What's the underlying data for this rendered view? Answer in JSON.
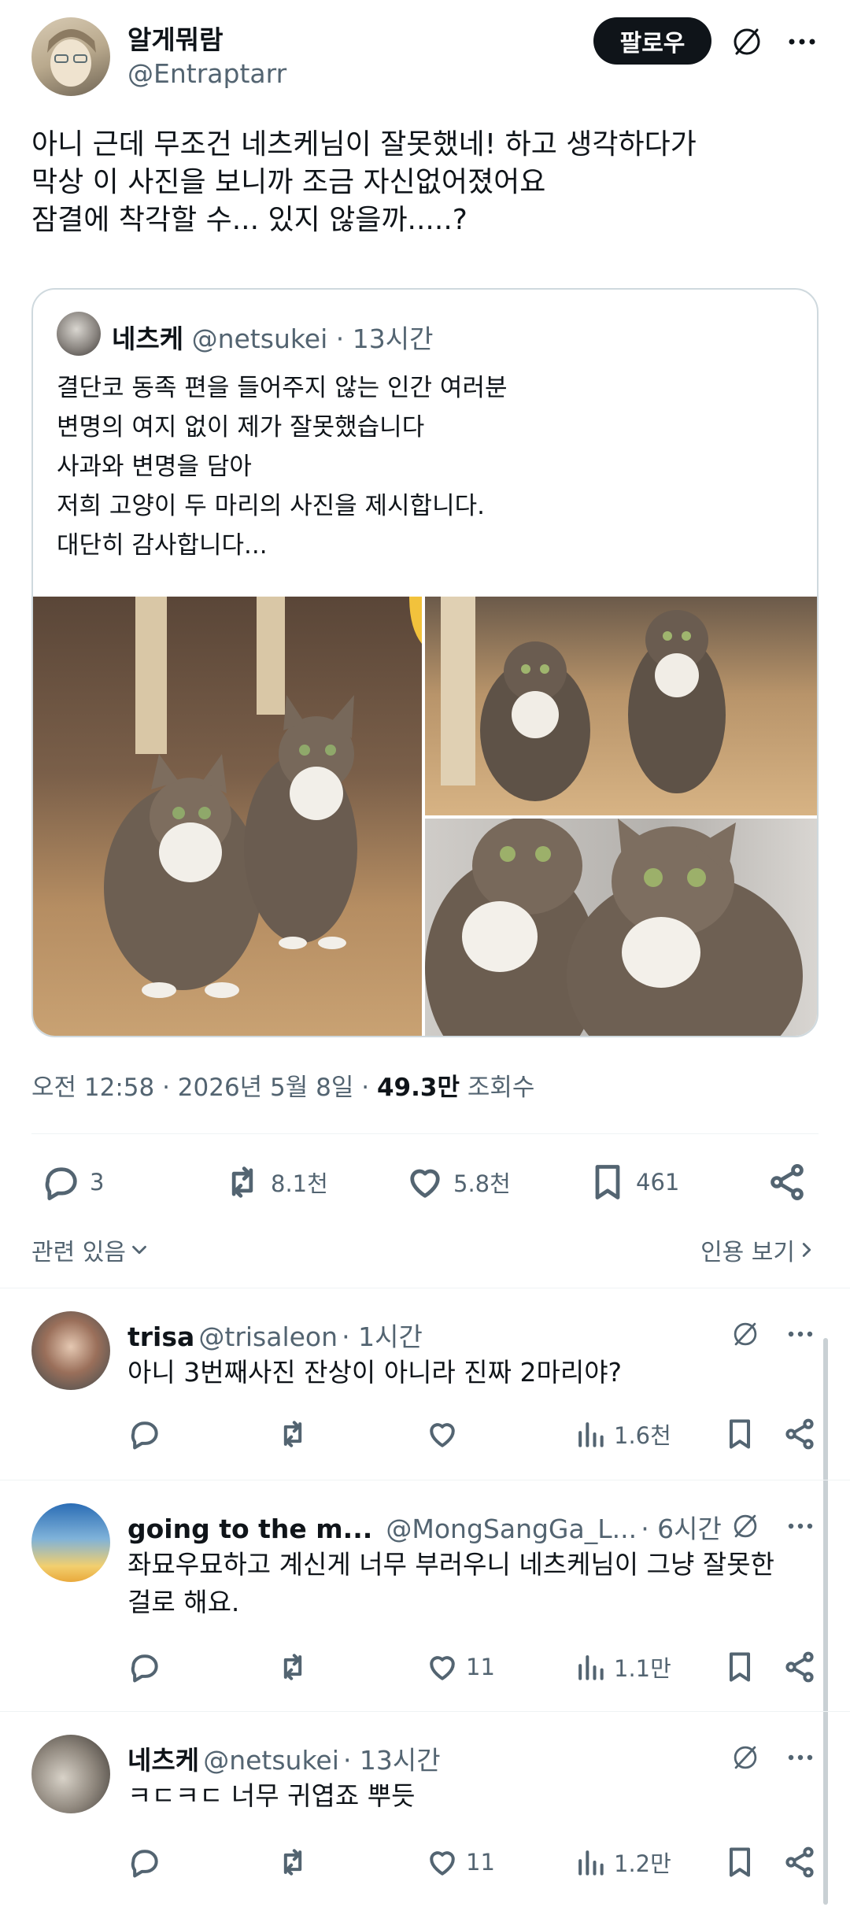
{
  "post": {
    "author_name": "알게뭐람",
    "author_handle": "@Entraptarr",
    "follow_label": "팔로우",
    "text_lines": [
      "아니 근데 무조건 네츠케님이 잘못했네! 하고 생각하다가",
      "막상 이 사진을 보니까 조금 자신없어졌어요",
      "잠결에 착각할 수... 있지 않을까.....?"
    ],
    "timestamp": "오전 12:58 · 2026년 5월 8일 · ",
    "views_count": "49.3만",
    "views_label": "조회수",
    "replies": "3",
    "reposts": "8.1천",
    "likes": "5.8천",
    "bookmarks": "461",
    "related_label": "관련 있음",
    "quotes_label": "인용 보기"
  },
  "quote": {
    "author_name": "네츠케",
    "author_handle": "@netsukei",
    "time": "· 13시간",
    "text_lines": [
      "결단코 동족 편을 들어주지 않는 인간 여러분",
      "변명의 여지 없이 제가 잘못했습니다",
      "사과와 변명을 담아",
      "저희 고양이 두 마리의 사진을 제시합니다.",
      "대단히 감사합니다..."
    ]
  },
  "replies": [
    {
      "name": "trisa",
      "handle": "@trisaleon",
      "time": "· 1시간",
      "text_lines": [
        "아니 3번째사진 잔상이 아니라 진짜 2마리야?"
      ],
      "likes": "",
      "views": "1.6천"
    },
    {
      "name": "going to the m...",
      "handle": "@MongSangGa_L...",
      "time": "· 6시간",
      "text_lines": [
        "좌묘우묘하고 계신게 너무 부러우니 네츠케님이 그냥 잘못한",
        "걸로 해요."
      ],
      "likes": "11",
      "views": "1.1만"
    },
    {
      "name": "네츠케",
      "handle": "@netsukei",
      "time": "· 13시간",
      "text_lines": [
        "ㅋㄷㅋㄷ 너무 귀엽죠 뿌듯"
      ],
      "likes": "11",
      "views": "1.2만"
    }
  ],
  "icons": {
    "reply": "speech-bubble-icon",
    "repost": "repost-arrows-icon",
    "like": "heart-icon",
    "bookmark": "bookmark-icon",
    "share": "share-icon",
    "grok": "grok-slash-icon",
    "more": "more-dots-icon",
    "views": "bar-chart-icon"
  },
  "colors": {
    "text": "#0f1419",
    "secondary": "#536471",
    "border": "#cfd9de"
  }
}
